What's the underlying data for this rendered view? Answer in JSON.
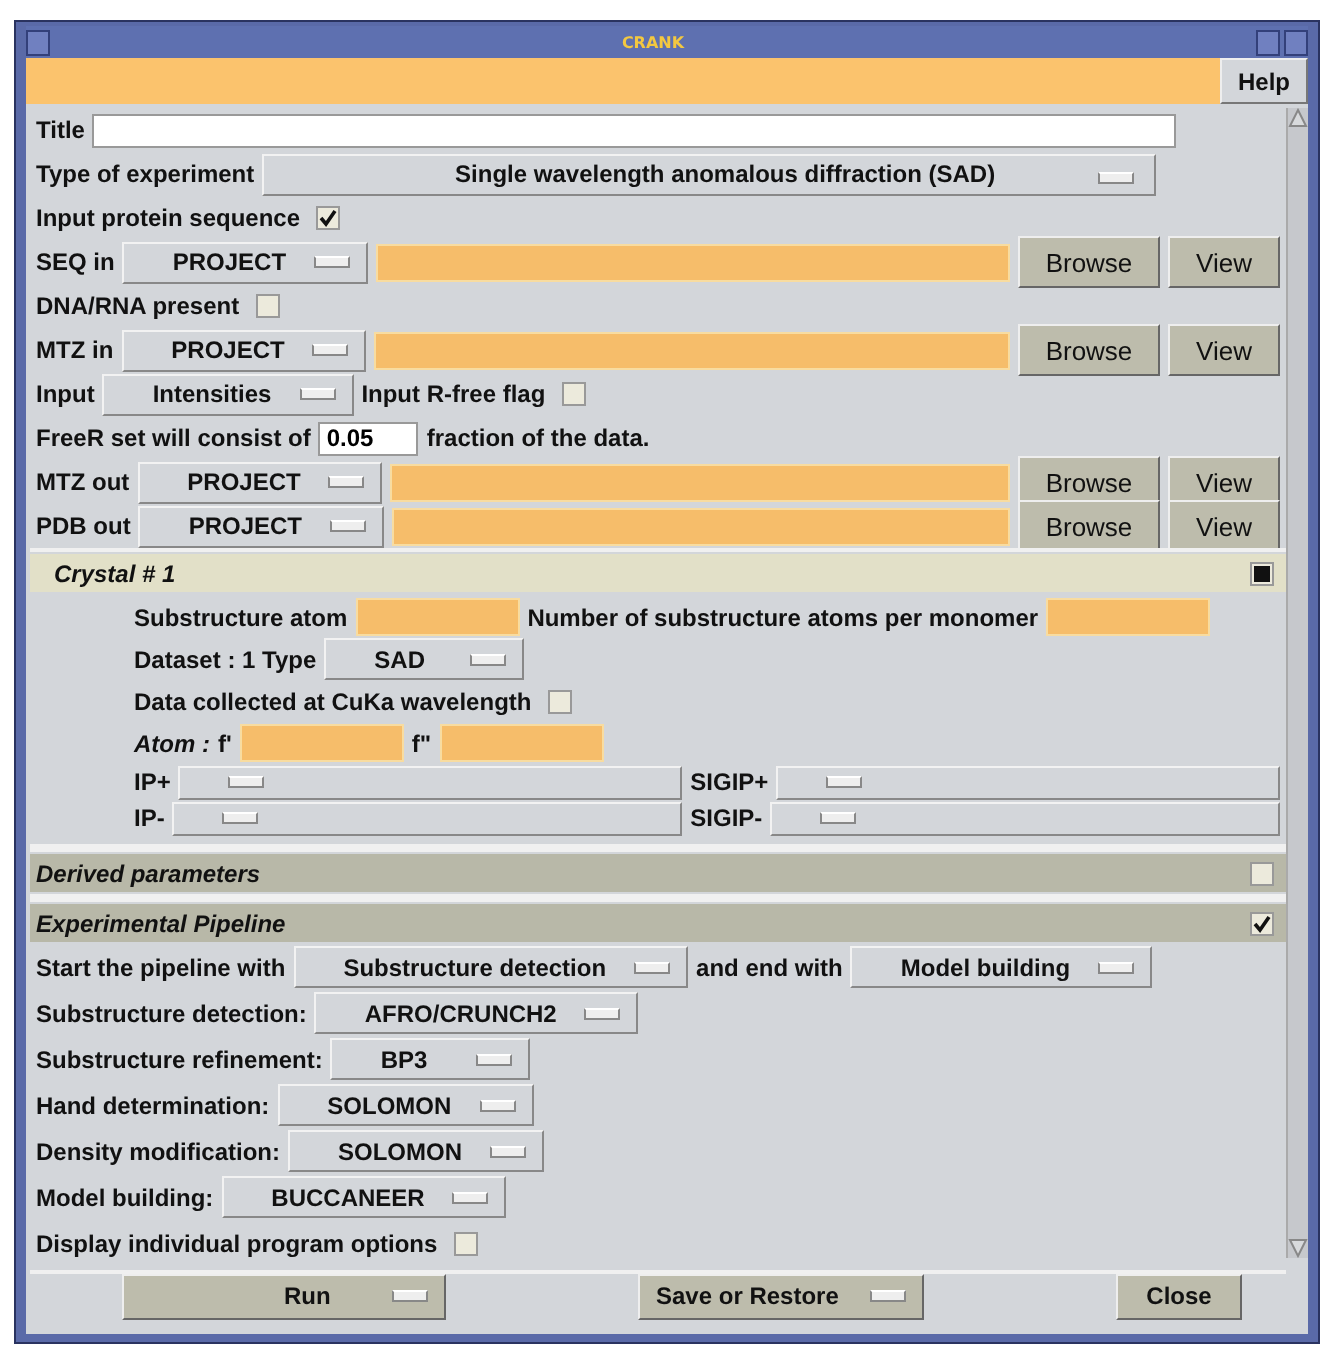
{
  "window": {
    "title": "CRANK"
  },
  "toolbar": {
    "help_button": "Help"
  },
  "rows": [
    {
      "items": [
        {
          "kind": "label",
          "text": "Title"
        },
        {
          "kind": "long_field"
        }
      ]
    },
    {
      "items": [
        {
          "kind": "label",
          "text": "Type of experiment"
        },
        {
          "kind": "wide_menu",
          "label": "Single wavelength anomalous diffraction (SAD)"
        }
      ]
    },
    {
      "items": [
        {
          "kind": "label",
          "text": "Input protein sequence"
        },
        {
          "kind": "check",
          "checked": true
        }
      ]
    },
    {
      "items": [
        {
          "kind": "label",
          "text": "SEQ in"
        },
        {
          "kind": "menu",
          "label": "PROJECT"
        },
        {
          "kind": "file_field"
        },
        {
          "kind": "button",
          "label": "Browse"
        },
        {
          "kind": "button",
          "label": "View"
        }
      ]
    },
    {
      "items": [
        {
          "kind": "label",
          "text": "DNA/RNA present"
        },
        {
          "kind": "check",
          "checked": false
        }
      ]
    },
    {
      "items": [
        {
          "kind": "label",
          "text": "MTZ in"
        },
        {
          "kind": "menu",
          "label": "PROJECT"
        },
        {
          "kind": "file_field"
        },
        {
          "kind": "button",
          "label": "Browse"
        },
        {
          "kind": "button",
          "label": "View"
        }
      ]
    },
    {
      "items": [
        {
          "kind": "label",
          "text": "Input"
        },
        {
          "kind": "menu",
          "label": "Intensities"
        },
        {
          "kind": "label",
          "text": "Input R-free flag"
        },
        {
          "kind": "check",
          "checked": false
        }
      ]
    },
    {
      "items": [
        {
          "kind": "label",
          "text": "FreeR set will consist of"
        },
        {
          "kind": "text_field",
          "value": "0.05"
        },
        {
          "kind": "label",
          "text": "fraction of the data."
        }
      ]
    },
    {
      "items": [
        {
          "kind": "label",
          "text": "MTZ out"
        },
        {
          "kind": "menu",
          "label": "PROJECT"
        },
        {
          "kind": "file_field"
        },
        {
          "kind": "button",
          "label": "Browse"
        },
        {
          "kind": "button",
          "label": "View"
        }
      ]
    },
    {
      "items": [
        {
          "kind": "label",
          "text": "PDB out"
        },
        {
          "kind": "menu",
          "label": "PROJECT"
        },
        {
          "kind": "file_field"
        },
        {
          "kind": "button",
          "label": "Browse"
        },
        {
          "kind": "button",
          "label": "View"
        }
      ]
    }
  ],
  "sections": [
    {
      "kind": "sub",
      "title": "Crystal # 1",
      "checked": true,
      "rows": [
        {
          "items": [
            {
              "kind": "label",
              "text": "Substructure atom"
            },
            {
              "kind": "short_field"
            },
            {
              "kind": "label",
              "text": "Number of substructure atoms per monomer"
            },
            {
              "kind": "short_field"
            }
          ]
        },
        {
          "items": [
            {
              "kind": "label",
              "text": "Dataset : 1  Type"
            },
            {
              "kind": "menu",
              "label": "SAD"
            }
          ]
        },
        {
          "items": [
            {
              "kind": "label",
              "text": "Data collected at CuKa wavelength"
            },
            {
              "kind": "check",
              "checked": false
            }
          ]
        },
        {
          "items": [
            {
              "kind": "italic_label",
              "text": "Atom :"
            },
            {
              "kind": "label",
              "text": "f'"
            },
            {
              "kind": "short_field"
            },
            {
              "kind": "label",
              "text": "f\""
            },
            {
              "kind": "short_field"
            }
          ]
        },
        {
          "items": [
            {
              "kind": "label",
              "text": "IP+"
            },
            {
              "kind": "empty_menu"
            },
            {
              "kind": "label",
              "text": "SIGIP+"
            },
            {
              "kind": "empty_menu"
            }
          ]
        },
        {
          "items": [
            {
              "kind": "label",
              "text": "IP-"
            },
            {
              "kind": "empty_menu"
            },
            {
              "kind": "label",
              "text": "SIGIP-"
            },
            {
              "kind": "empty_menu"
            }
          ]
        }
      ]
    },
    {
      "kind": "main",
      "title": "Derived parameters",
      "checked": false
    },
    {
      "kind": "main",
      "title": "Experimental Pipeline",
      "checked": true,
      "rows": [
        {
          "items": [
            {
              "kind": "label",
              "text": "Start the pipeline with"
            },
            {
              "kind": "menu",
              "label": "Substructure detection"
            },
            {
              "kind": "label",
              "text": "and end with"
            },
            {
              "kind": "menu",
              "label": "Model building"
            }
          ]
        },
        {
          "items": [
            {
              "kind": "label",
              "text": "Substructure detection:"
            },
            {
              "kind": "menu",
              "label": "AFRO/CRUNCH2"
            }
          ]
        },
        {
          "items": [
            {
              "kind": "label",
              "text": "Substructure refinement:"
            },
            {
              "kind": "menu",
              "label": "BP3"
            }
          ]
        },
        {
          "items": [
            {
              "kind": "label",
              "text": "Hand determination:"
            },
            {
              "kind": "menu",
              "label": "SOLOMON"
            }
          ]
        },
        {
          "items": [
            {
              "kind": "label",
              "text": "Density modification:"
            },
            {
              "kind": "menu",
              "label": "SOLOMON"
            }
          ]
        },
        {
          "items": [
            {
              "kind": "label",
              "text": "Model building:"
            },
            {
              "kind": "menu",
              "label": "BUCCANEER"
            }
          ]
        },
        {
          "items": [
            {
              "kind": "label",
              "text": "Display individual program options"
            },
            {
              "kind": "check",
              "checked": false
            }
          ]
        }
      ]
    }
  ],
  "footer": [
    {
      "kind": "menu_button",
      "label": "Run"
    },
    {
      "kind": "menu_button",
      "label": "Save or Restore"
    },
    {
      "kind": "button",
      "label": "Close"
    }
  ]
}
